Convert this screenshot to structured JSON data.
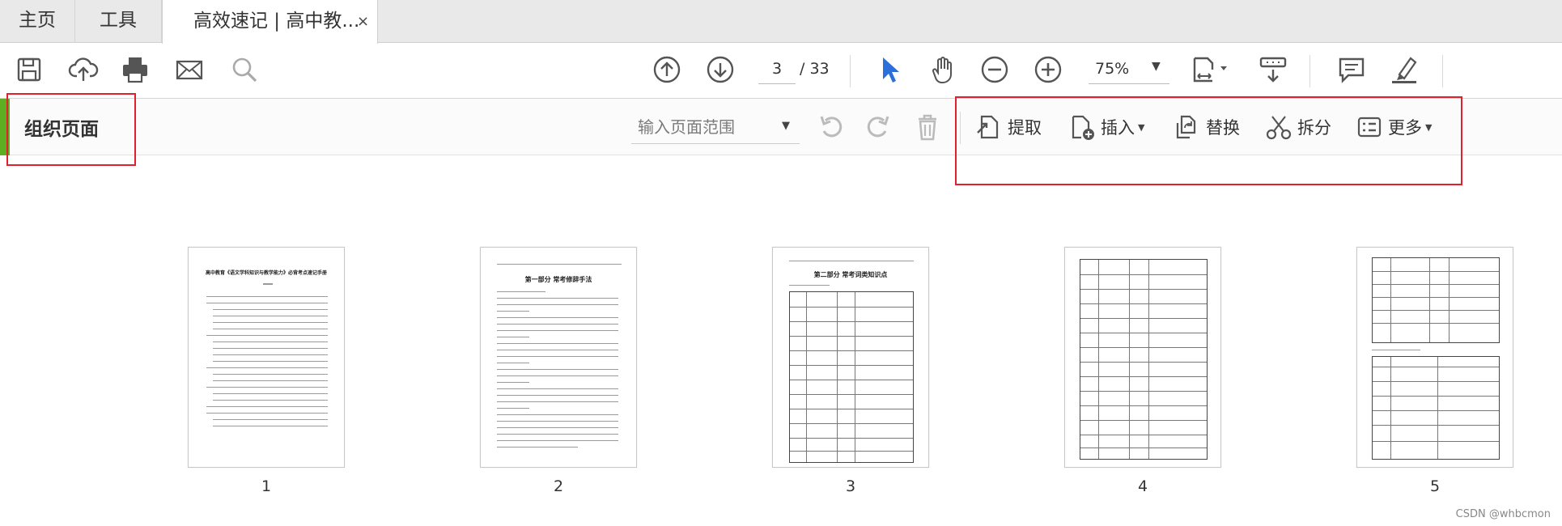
{
  "tabs": {
    "home": "主页",
    "tools": "工具",
    "document": "高效速记 | 高中教...",
    "close": "×"
  },
  "toolbar": {
    "icons": [
      "save-icon",
      "cloud-upload-icon",
      "print-icon",
      "email-icon",
      "search-icon",
      "previous-page-icon",
      "next-page-icon",
      "select-pointer-icon",
      "hand-icon",
      "zoom-out-icon",
      "zoom-in-icon",
      "fit-page-icon",
      "scroll-mode-icon",
      "comment-icon",
      "highlight-pen-icon"
    ],
    "current_page": "3",
    "page_total": "/ 33",
    "zoom": "75%"
  },
  "organize": {
    "title": "组织页面",
    "range_placeholder": "输入页面范围",
    "extract": "提取",
    "insert": "插入",
    "replace": "替换",
    "split": "拆分",
    "more": "更多"
  },
  "thumbnails": [
    {
      "number": "1",
      "heading": "高中教育《语文学科知识与教学能力》必背考点速记手册"
    },
    {
      "number": "2",
      "heading": "第一部分 常考修辞手法"
    },
    {
      "number": "3",
      "heading": "第二部分 常考词类知识点"
    },
    {
      "number": "4",
      "heading": ""
    },
    {
      "number": "5",
      "heading": ""
    }
  ],
  "colors": {
    "accent_green": "#5fae22",
    "annotation_red": "#e0202a",
    "pointer_blue": "#2a6fdb"
  },
  "watermark": "CSDN @whbcmon"
}
